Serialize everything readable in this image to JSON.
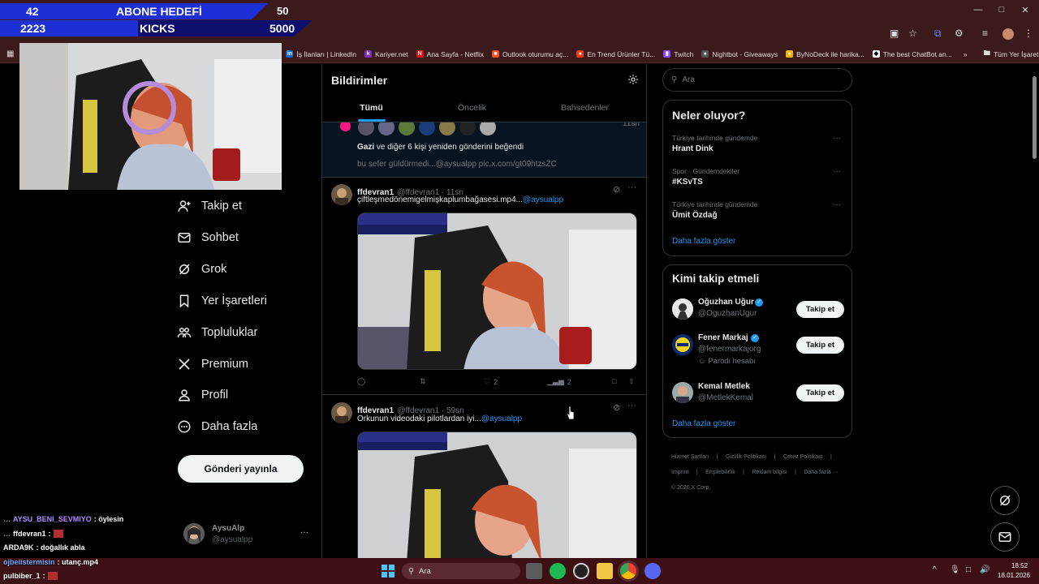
{
  "overlay": {
    "row1_left": "42",
    "row1_title": "ABONE HEDEFİ",
    "row1_right": "50",
    "row2_left": "2223",
    "row2_title": "KICKS",
    "row2_right": "5000"
  },
  "bookmarks": [
    {
      "label": "İş İlanları | LinkedIn",
      "icon": "linkedin-icon",
      "color": "#0a66c2",
      "glyph": "in"
    },
    {
      "label": "Kariyer.net",
      "icon": "kariyer-icon",
      "color": "#7b2fbe",
      "glyph": "k"
    },
    {
      "label": "Ana Sayfa - Netflix",
      "icon": "netflix-icon",
      "color": "#e50914",
      "glyph": "N"
    },
    {
      "label": "Outlook oturumu aç...",
      "icon": "outlook-icon",
      "color": "#f25022",
      "glyph": "■"
    },
    {
      "label": "En Trend Ürünler Tü...",
      "icon": "trendyol-icon",
      "color": "#e63b16",
      "glyph": "●"
    },
    {
      "label": "Twitch",
      "icon": "twitch-icon",
      "color": "#9146ff",
      "glyph": "▮"
    },
    {
      "label": "Nightbot - Giveaways",
      "icon": "nightbot-icon",
      "color": "#555",
      "glyph": "●"
    },
    {
      "label": "ByNoDeck ile harika...",
      "icon": "bynodeck-icon",
      "color": "#f4b400",
      "glyph": "●"
    },
    {
      "label": "The best ChatBot an...",
      "icon": "chatbot-icon",
      "color": "#fff",
      "glyph": "◆"
    }
  ],
  "bookmarks_more": "»",
  "all_bookmarks": "Tüm Yer İşaretleri",
  "nav": {
    "follow": "Takip et",
    "chat": "Sohbet",
    "grok": "Grok",
    "bookmarks": "Yer İşaretleri",
    "communities": "Topluluklar",
    "premium": "Premium",
    "profile": "Profil",
    "more": "Daha fazla",
    "post_button": "Gönderi yayınla",
    "account_name": "AysuAlp",
    "account_handle": "@aysualpp",
    "account_more": "···"
  },
  "center": {
    "title": "Bildirimler",
    "tabs": [
      "Tümü",
      "Öncelik",
      "Bahsedenler"
    ],
    "notif_time": "11sn",
    "notif_text_bold": "Gazi",
    "notif_text": " ve diğer 6 kişi yeniden gönderini beğendi",
    "notif_preview": "bu sefer güldürmedi...@aysualpp pic.x.com/gt09htzsZC",
    "tweets": [
      {
        "name": "ffdevran1",
        "meta": "@ffdevran1 · 11sn",
        "text": "çiftleşmedönemigelmişkaplumbağasesi.mp4...",
        "mention": "@aysualpp",
        "replies": "",
        "retweets": "",
        "likes": "2",
        "views": "2"
      },
      {
        "name": "ffdevran1",
        "meta": "@ffdevran1 · 59sn",
        "text": "Orkunun videodaki pilotlardan iyi...",
        "mention": "@aysualpp"
      }
    ]
  },
  "right": {
    "search_placeholder": "Ara",
    "whats_happening": "Neler oluyor?",
    "trends": [
      {
        "context": "Türkiye tarihinde gündemde",
        "title": "Hrant Dink"
      },
      {
        "context": "Spor · Gündemdekiler",
        "title": "#KSvTS"
      },
      {
        "context": "Türkiye tarihinde gündemde",
        "title": "Ümit Özdağ"
      }
    ],
    "show_more": "Daha fazla göster",
    "who_to_follow": "Kimi takip etmeli",
    "suggestions": [
      {
        "name": "Oğuzhan Uğur",
        "handle": "@OguzhanUgur",
        "extra": "",
        "button": "Takip et"
      },
      {
        "name": "Fener Markaj",
        "handle": "@fenermarkajorg",
        "extra": "Parodi hesabı",
        "button": "Takip et"
      },
      {
        "name": "Kemal Metlek",
        "handle": "@MetlekKemal",
        "extra": "",
        "button": "Takip et"
      }
    ],
    "show_more2": "Daha fazla göster",
    "footer": [
      "Hizmet Şartları",
      "|",
      "Gizlilik Politikası",
      "|",
      "Çerez Politikası",
      "|",
      "Imprint",
      "|",
      "Erişilebilirlik",
      "|",
      "Reklam bilgisi",
      "|",
      "Daha fazla ···",
      "© 2026 X Corp."
    ]
  },
  "chat": [
    {
      "user": "AYSU_BENI_SEVMIYO",
      "color": "#b18cff",
      "msg": ": öylesin",
      "emote": false
    },
    {
      "user": "ffdevran1",
      "color": "#ffffff",
      "msg": ":",
      "emote": true
    },
    {
      "user": "ARDA9K",
      "color": "#ffffff",
      "msg": ": doğallık abla",
      "emote": false
    },
    {
      "user": "ojbeiistermisin",
      "color": "#6aa8ff",
      "msg": ": utanç.mp4",
      "emote": false
    },
    {
      "user": "pulbiber_1",
      "color": "#ffffff",
      "msg": ":",
      "emote": true
    }
  ],
  "taskbar": {
    "search": "Ara",
    "time": "18:52",
    "date": "18.01.2026"
  },
  "colors": {
    "accent": "#1d9bf0",
    "chrome": "#3b1a1c",
    "taskbar": "#3d1114",
    "overlay": "#1f2fd6"
  }
}
